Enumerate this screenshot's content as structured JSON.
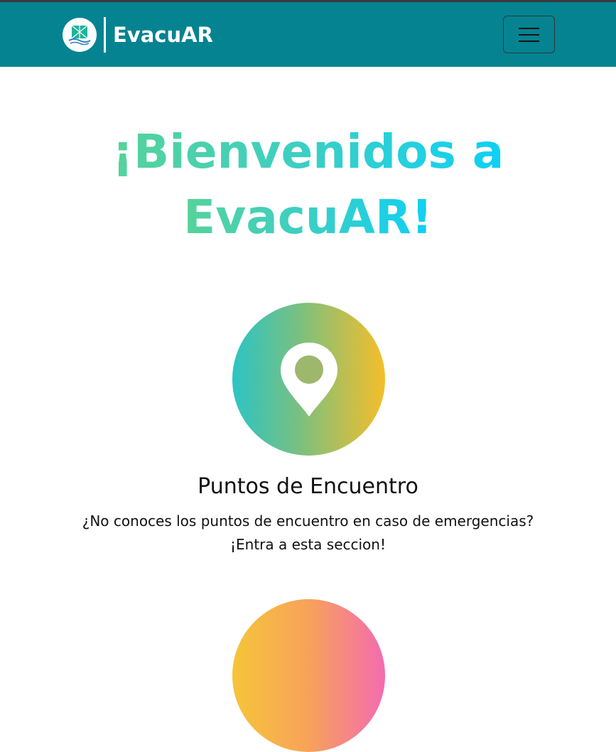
{
  "navbar": {
    "brand_name": "EvacuAR",
    "logo_icon": "evacuar-logo-icon",
    "menu_icon": "hamburger-menu-icon",
    "colors": {
      "background": "#058391",
      "text": "#ffffff"
    }
  },
  "hero": {
    "line1": "¡Bienvenidos a",
    "line2": "EvacuAR!",
    "gradient": [
      "#56d39a",
      "#0ed0f5"
    ]
  },
  "sections": [
    {
      "icon": "map-pin-icon",
      "title": "Puntos de Encuentro",
      "description_line1": "¿No conoces los puntos de encuentro en caso de emergencias?",
      "description_line2": "¡Entra a esta seccion!",
      "gradient": [
        "#2bc4c4",
        "#f5be2a"
      ]
    },
    {
      "gradient": [
        "#f6c53a",
        "#f46bb0"
      ]
    }
  ]
}
